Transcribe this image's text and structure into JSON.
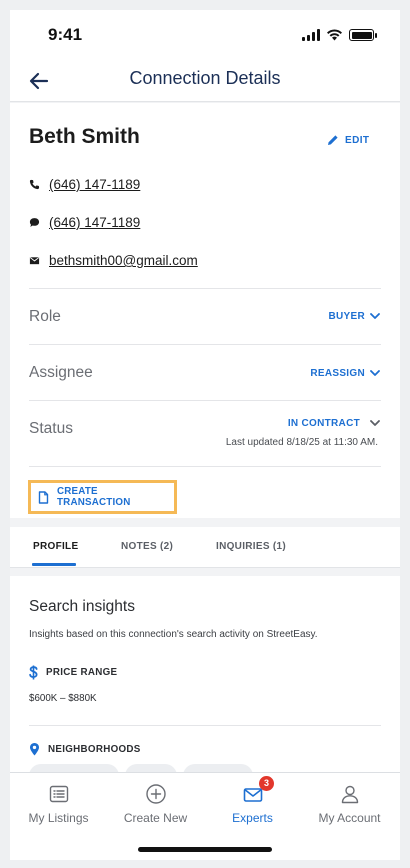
{
  "status_bar": {
    "time": "9:41"
  },
  "header": {
    "title": "Connection Details"
  },
  "contact": {
    "name": "Beth Smith",
    "edit_label": "EDIT",
    "phone": "(646) 147-1189",
    "sms": "(646) 147-1189",
    "email": "bethsmith00@gmail.com"
  },
  "fields": {
    "role": {
      "label": "Role",
      "value": "BUYER"
    },
    "assignee": {
      "label": "Assignee",
      "value": "REASSIGN"
    },
    "status": {
      "label": "Status",
      "value": "IN CONTRACT",
      "updated": "Last updated 8/18/25 at 11:30 AM."
    }
  },
  "create_transaction": {
    "label": "CREATE TRANSACTION"
  },
  "tabs": [
    {
      "label": "PROFILE",
      "active": true
    },
    {
      "label": "NOTES (2)",
      "active": false
    },
    {
      "label": "INQUIRIES (1)",
      "active": false
    }
  ],
  "insights": {
    "title": "Search insights",
    "description": "Insights based on this connection's search activity on StreetEasy.",
    "price_range": {
      "label": "PRICE RANGE",
      "value": "$600K – $880K"
    },
    "neighborhoods": {
      "label": "NEIGHBORHOODS"
    }
  },
  "bottom_nav": {
    "items": [
      {
        "label": "My Listings",
        "icon": "listings-icon"
      },
      {
        "label": "Create New",
        "icon": "plus-circle-icon"
      },
      {
        "label": "Experts",
        "icon": "mail-icon",
        "badge": "3",
        "active": true
      },
      {
        "label": "My Account",
        "icon": "account-icon"
      }
    ]
  },
  "colors": {
    "accent": "#1d6fd1",
    "title": "#1b2f56",
    "highlight": "#f5b956",
    "badge": "#e2372c"
  }
}
